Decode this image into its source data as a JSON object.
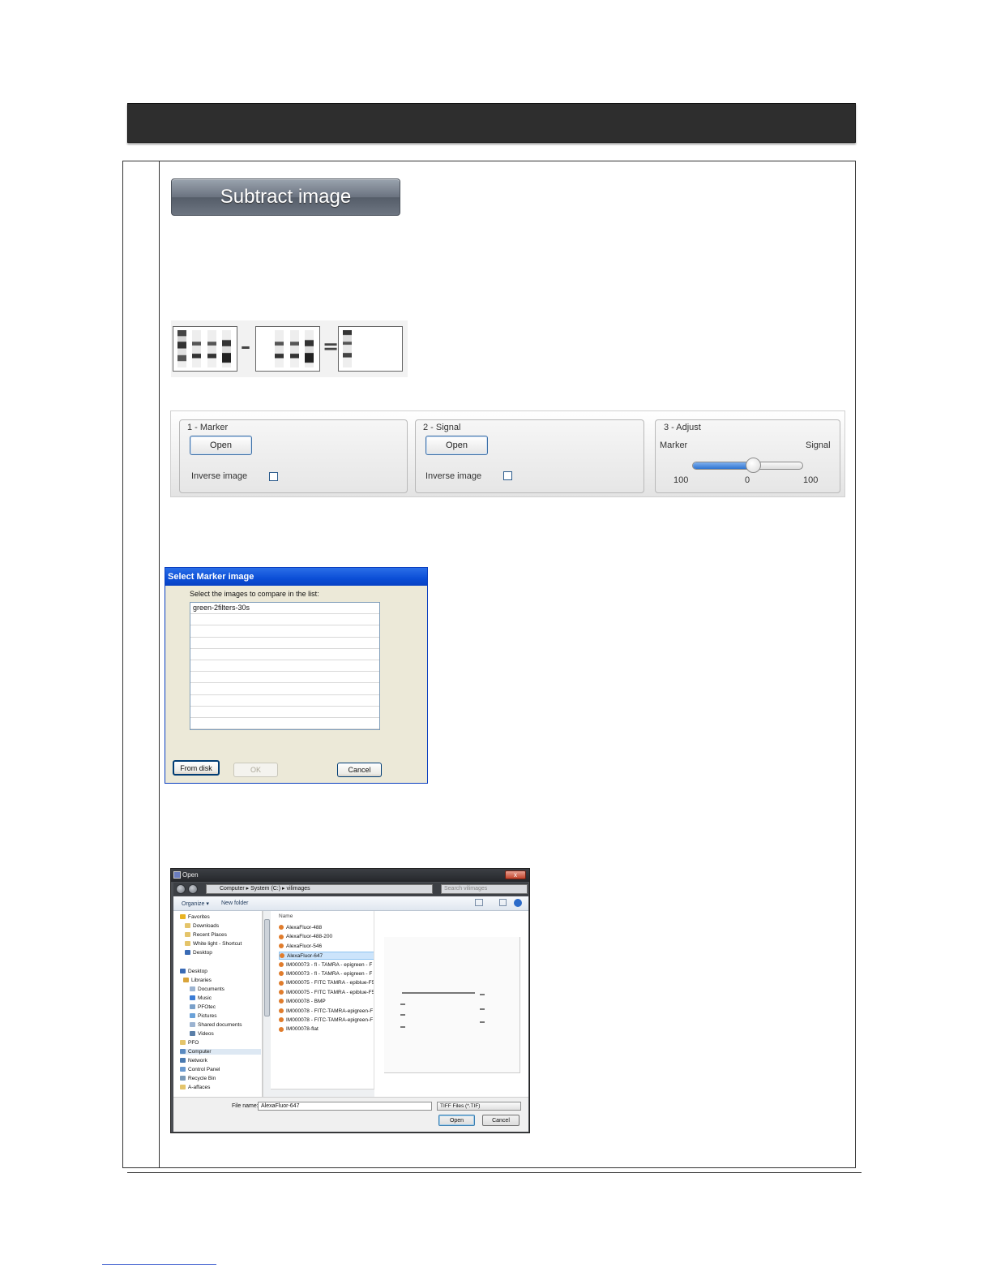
{
  "subtract_button_label": "Subtract image",
  "toolbar": {
    "marker": {
      "title": "1 - Marker",
      "open_label": "Open",
      "inverse_label": "Inverse image"
    },
    "signal": {
      "title": "2 - Signal",
      "open_label": "Open",
      "inverse_label": "Inverse image"
    },
    "adjust": {
      "title": "3 - Adjust",
      "left_label": "Marker",
      "right_label": "Signal",
      "tick_left": "100",
      "tick_center": "0",
      "tick_right": "100",
      "slider_fraction": 0.55
    }
  },
  "marker_dialog": {
    "title": "Select Marker image",
    "hint": "Select the images to compare in the list:",
    "items": [
      "green-2filters-30s"
    ],
    "from_disk_label": "From disk",
    "ok_label": "OK",
    "cancel_label": "Cancel"
  },
  "open_dialog": {
    "title": "Open",
    "close_glyph": "x",
    "address": "Computer ▸ System (C:) ▸ vilimages",
    "search_placeholder": "Search vilimages",
    "organize_label": "Organize ▾",
    "new_folder_label": "New folder",
    "nav_items": [
      {
        "label": "Favorites",
        "icon": "star-icon",
        "color": "#e8b323"
      },
      {
        "label": "Downloads",
        "icon": "folder-icon",
        "color": "#e4c46a"
      },
      {
        "label": "Recent Places",
        "icon": "folder-icon",
        "color": "#e4c46a"
      },
      {
        "label": "White light - Shortcut",
        "icon": "folder-icon",
        "color": "#e4c46a"
      },
      {
        "label": "Desktop",
        "icon": "desktop-icon",
        "color": "#3a6bb5"
      },
      {
        "label": "Desktop",
        "icon": "desktop-icon",
        "color": "#3a6bb5"
      },
      {
        "label": "Libraries",
        "icon": "library-icon",
        "color": "#d9a43a"
      },
      {
        "label": "Documents",
        "icon": "document-icon",
        "color": "#9bb3d1"
      },
      {
        "label": "Music",
        "icon": "music-icon",
        "color": "#3a7bd5"
      },
      {
        "label": "PFOtec",
        "icon": "folder-icon",
        "color": "#7aa0c9"
      },
      {
        "label": "Pictures",
        "icon": "picture-icon",
        "color": "#6aa1d8"
      },
      {
        "label": "Shared documents",
        "icon": "folder-icon",
        "color": "#9bb3d1"
      },
      {
        "label": "Videos",
        "icon": "video-icon",
        "color": "#5a7fa8"
      },
      {
        "label": "PFO",
        "icon": "folder-icon",
        "color": "#e4c46a"
      },
      {
        "label": "Computer",
        "icon": "computer-icon",
        "color": "#5a8ac0"
      },
      {
        "label": "Network",
        "icon": "network-icon",
        "color": "#4a7ab0"
      },
      {
        "label": "Control Panel",
        "icon": "control-panel-icon",
        "color": "#6a9ad0"
      },
      {
        "label": "Recycle Bin",
        "icon": "recycle-bin-icon",
        "color": "#7a9ab8"
      },
      {
        "label": "A-affaces",
        "icon": "folder-icon",
        "color": "#e4c46a"
      }
    ],
    "column_header": "Name",
    "files": [
      "AlexaFluor-488",
      "AlexaFluor-488-200",
      "AlexaFluor-546",
      "AlexaFluor-647",
      "IM000073 - fl - TAMRA - epigreen - F",
      "IM000073 - fl - TAMRA - epigreen - F",
      "IM000075 - FITC TAMRA - epiblue-F5",
      "IM000075 - FITC TAMRA - epiblue-F5",
      "IM000078 - BMP",
      "IM000078 - FITC-TAMRA-epigreen-F",
      "IM000078 - FITC-TAMRA-epigreen-F",
      "IM000078-flat"
    ],
    "selected_file_index": 3,
    "file_name_label": "File name:",
    "file_name_value": "AlexaFluor-647",
    "file_type": "TIFF Files (*.TIF)",
    "open_label": "Open",
    "cancel_label": "Cancel"
  }
}
